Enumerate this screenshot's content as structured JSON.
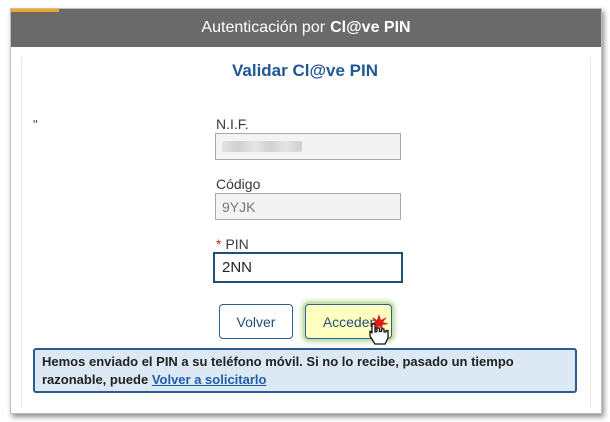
{
  "header": {
    "prefix": "Autenticación por",
    "brand": "Cl@ve PIN",
    "background_color": "#6a6a6a",
    "accent_color": "#f2a81d"
  },
  "form": {
    "title": "Validar Cl@ve PIN",
    "stray_mark": "\"",
    "nif": {
      "label": "N.I.F.",
      "value": ""
    },
    "codigo": {
      "label": "Código",
      "value": "9YJK"
    },
    "pin": {
      "required_marker": "*",
      "label": "PIN",
      "value": "2NN"
    }
  },
  "buttons": {
    "back_label": "Volver",
    "enter_label": "Acceder"
  },
  "notice": {
    "text": "Hemos enviado el PIN a su teléfono móvil. Si no lo recibe, pasado un tiempo razonable, puede ",
    "link_label": "Volver a solicitarlo"
  },
  "icons": {
    "cursor": "hand-pointer-icon",
    "click_marker": "red-asterisk-click-icon"
  },
  "colors": {
    "title": "#1f5896",
    "required": "#d81e1e",
    "notice_bg": "#dce8f3",
    "notice_border": "#2b5b8f",
    "enter_bg": "#ffffc0"
  }
}
